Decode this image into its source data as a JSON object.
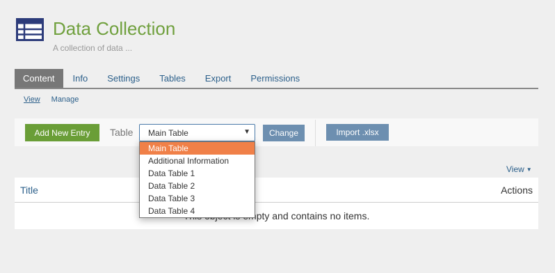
{
  "header": {
    "title": "Data Collection",
    "description": "A collection of data ...",
    "icon": "table-icon",
    "title_color": "#70a03e"
  },
  "tabs": [
    {
      "label": "Content",
      "active": true
    },
    {
      "label": "Info",
      "active": false
    },
    {
      "label": "Settings",
      "active": false
    },
    {
      "label": "Tables",
      "active": false
    },
    {
      "label": "Export",
      "active": false
    },
    {
      "label": "Permissions",
      "active": false
    }
  ],
  "subnav": [
    {
      "label": "View",
      "active": true
    },
    {
      "label": "Manage",
      "active": false
    }
  ],
  "toolbar": {
    "add_label": "Add New Entry",
    "table_label": "Table",
    "select_value": "Main Table",
    "change_label": "Change",
    "import_label": "Import .xlsx",
    "add_color": "#6a9e37",
    "button_color": "#6d8fb0"
  },
  "dropdown": {
    "options": [
      "Main Table",
      "Additional Information",
      "Data Table 1",
      "Data Table 2",
      "Data Table 3",
      "Data Table 4"
    ],
    "selected": "Main Table",
    "highlight_color": "#f08048"
  },
  "view_menu": {
    "label": "View",
    "icon": "caret-down-icon"
  },
  "listing": {
    "columns": {
      "title": "Title",
      "actions": "Actions"
    },
    "empty_message": "This object is empty and contains no items."
  }
}
